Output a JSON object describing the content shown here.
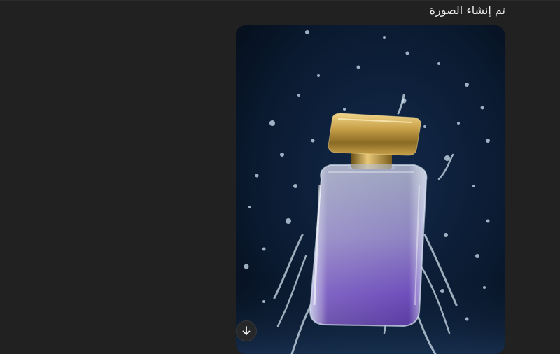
{
  "message": {
    "caption": "تم إنشاء الصورة"
  },
  "generated_image": {
    "subject": "perfume-bottle",
    "colors": {
      "background_top": "#0a1a30",
      "background_bottom": "#040a14",
      "glass_top": "#9aa4bf",
      "liquid_bottom": "#4b22a8",
      "cap_gold": "#c9a24a",
      "water": "#cfe3f2"
    }
  },
  "actions": {
    "download_icon": "arrow-down-icon"
  },
  "theme": {
    "page_background": "#212121",
    "text": "#ececec"
  }
}
